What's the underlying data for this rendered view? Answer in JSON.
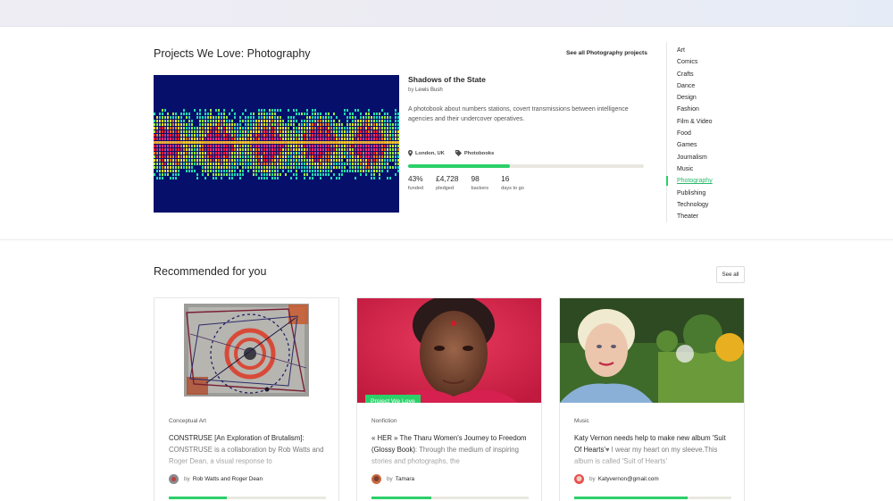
{
  "featured": {
    "section_title": "Projects We Love: Photography",
    "see_all": "See all Photography projects",
    "project": {
      "title": "Shadows of the State",
      "by": "by",
      "author": "Lewis Bush",
      "description": "A photobook about numbers stations, covert transmissions between intelligence agencies and their undercover operatives.",
      "location": "London, UK",
      "category": "Photobooks",
      "funded_fraction": 0.43,
      "stats": [
        {
          "value": "43%",
          "label": "funded"
        },
        {
          "value": "£4,728",
          "label": "pledged"
        },
        {
          "value": "98",
          "label": "backers"
        },
        {
          "value": "16",
          "label": "days to go"
        }
      ],
      "icons": {
        "location": "map-pin-icon",
        "category": "tag-icon"
      }
    }
  },
  "categories": {
    "items": [
      "Art",
      "Comics",
      "Crafts",
      "Dance",
      "Design",
      "Fashion",
      "Film & Video",
      "Food",
      "Games",
      "Journalism",
      "Music",
      "Photography",
      "Publishing",
      "Technology",
      "Theater"
    ],
    "active": "Photography"
  },
  "recommended": {
    "title": "Recommended for you",
    "see_all": "See all",
    "cards": [
      {
        "badge": "",
        "category": "Conceptual Art",
        "title": "CONSTRUSE [An Exploration of Brutalism]:",
        "blurb": "CONSTRUSE is a collaboration by Rob Watts and Roger Dean, a visual response to",
        "by": "by",
        "creator": "Rob Watts and Roger Dean",
        "progress_fraction": 0.37
      },
      {
        "badge": "Project We Love",
        "category": "Nonfiction",
        "title": "« HER » The Tharu Women's Journey to Freedom (Glossy Book)",
        "blurb": ": Through the medium of inspiring stories and photographs, the",
        "by": "by",
        "creator": "Tamara",
        "progress_fraction": 0.38
      },
      {
        "badge": "",
        "category": "Music",
        "title": "Katy Vernon needs help to make new album 'Suit Of Hearts'",
        "blurb": "♥ I wear my heart on my sleeve.This album is called 'Suit of Hearts'",
        "by": "by",
        "creator": "Katyvernon@gmail.com",
        "progress_fraction": 0.72
      }
    ]
  },
  "colors": {
    "accent": "#2bd069",
    "text": "#282828",
    "muted": "#777777"
  }
}
